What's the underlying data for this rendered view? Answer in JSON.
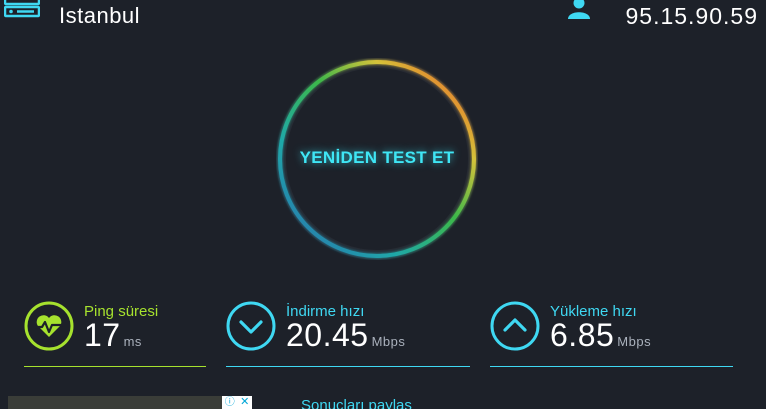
{
  "header": {
    "city": "Istanbul",
    "ip": "95.15.90.59",
    "server_icon": "server-icon",
    "user_icon": "user-icon"
  },
  "test": {
    "retest_label": "YENİDEN TEST ET"
  },
  "metrics": {
    "ping": {
      "label": "Ping süresi",
      "value": "17",
      "unit": "ms",
      "icon": "heart-pulse-icon"
    },
    "download": {
      "label": "İndirme hızı",
      "value": "20.45",
      "unit": "Mbps",
      "icon": "chevron-down-icon"
    },
    "upload": {
      "label": "Yükleme hızı",
      "value": "6.85",
      "unit": "Mbps",
      "icon": "chevron-up-icon"
    }
  },
  "footer": {
    "share_label": "Sonuçları paylaş",
    "ad_info_icon": "ⓘ",
    "ad_close_icon": "✕"
  },
  "colors": {
    "background": "#1d2129",
    "accent": "#3fd8f2",
    "ping": "#a6e22e"
  }
}
